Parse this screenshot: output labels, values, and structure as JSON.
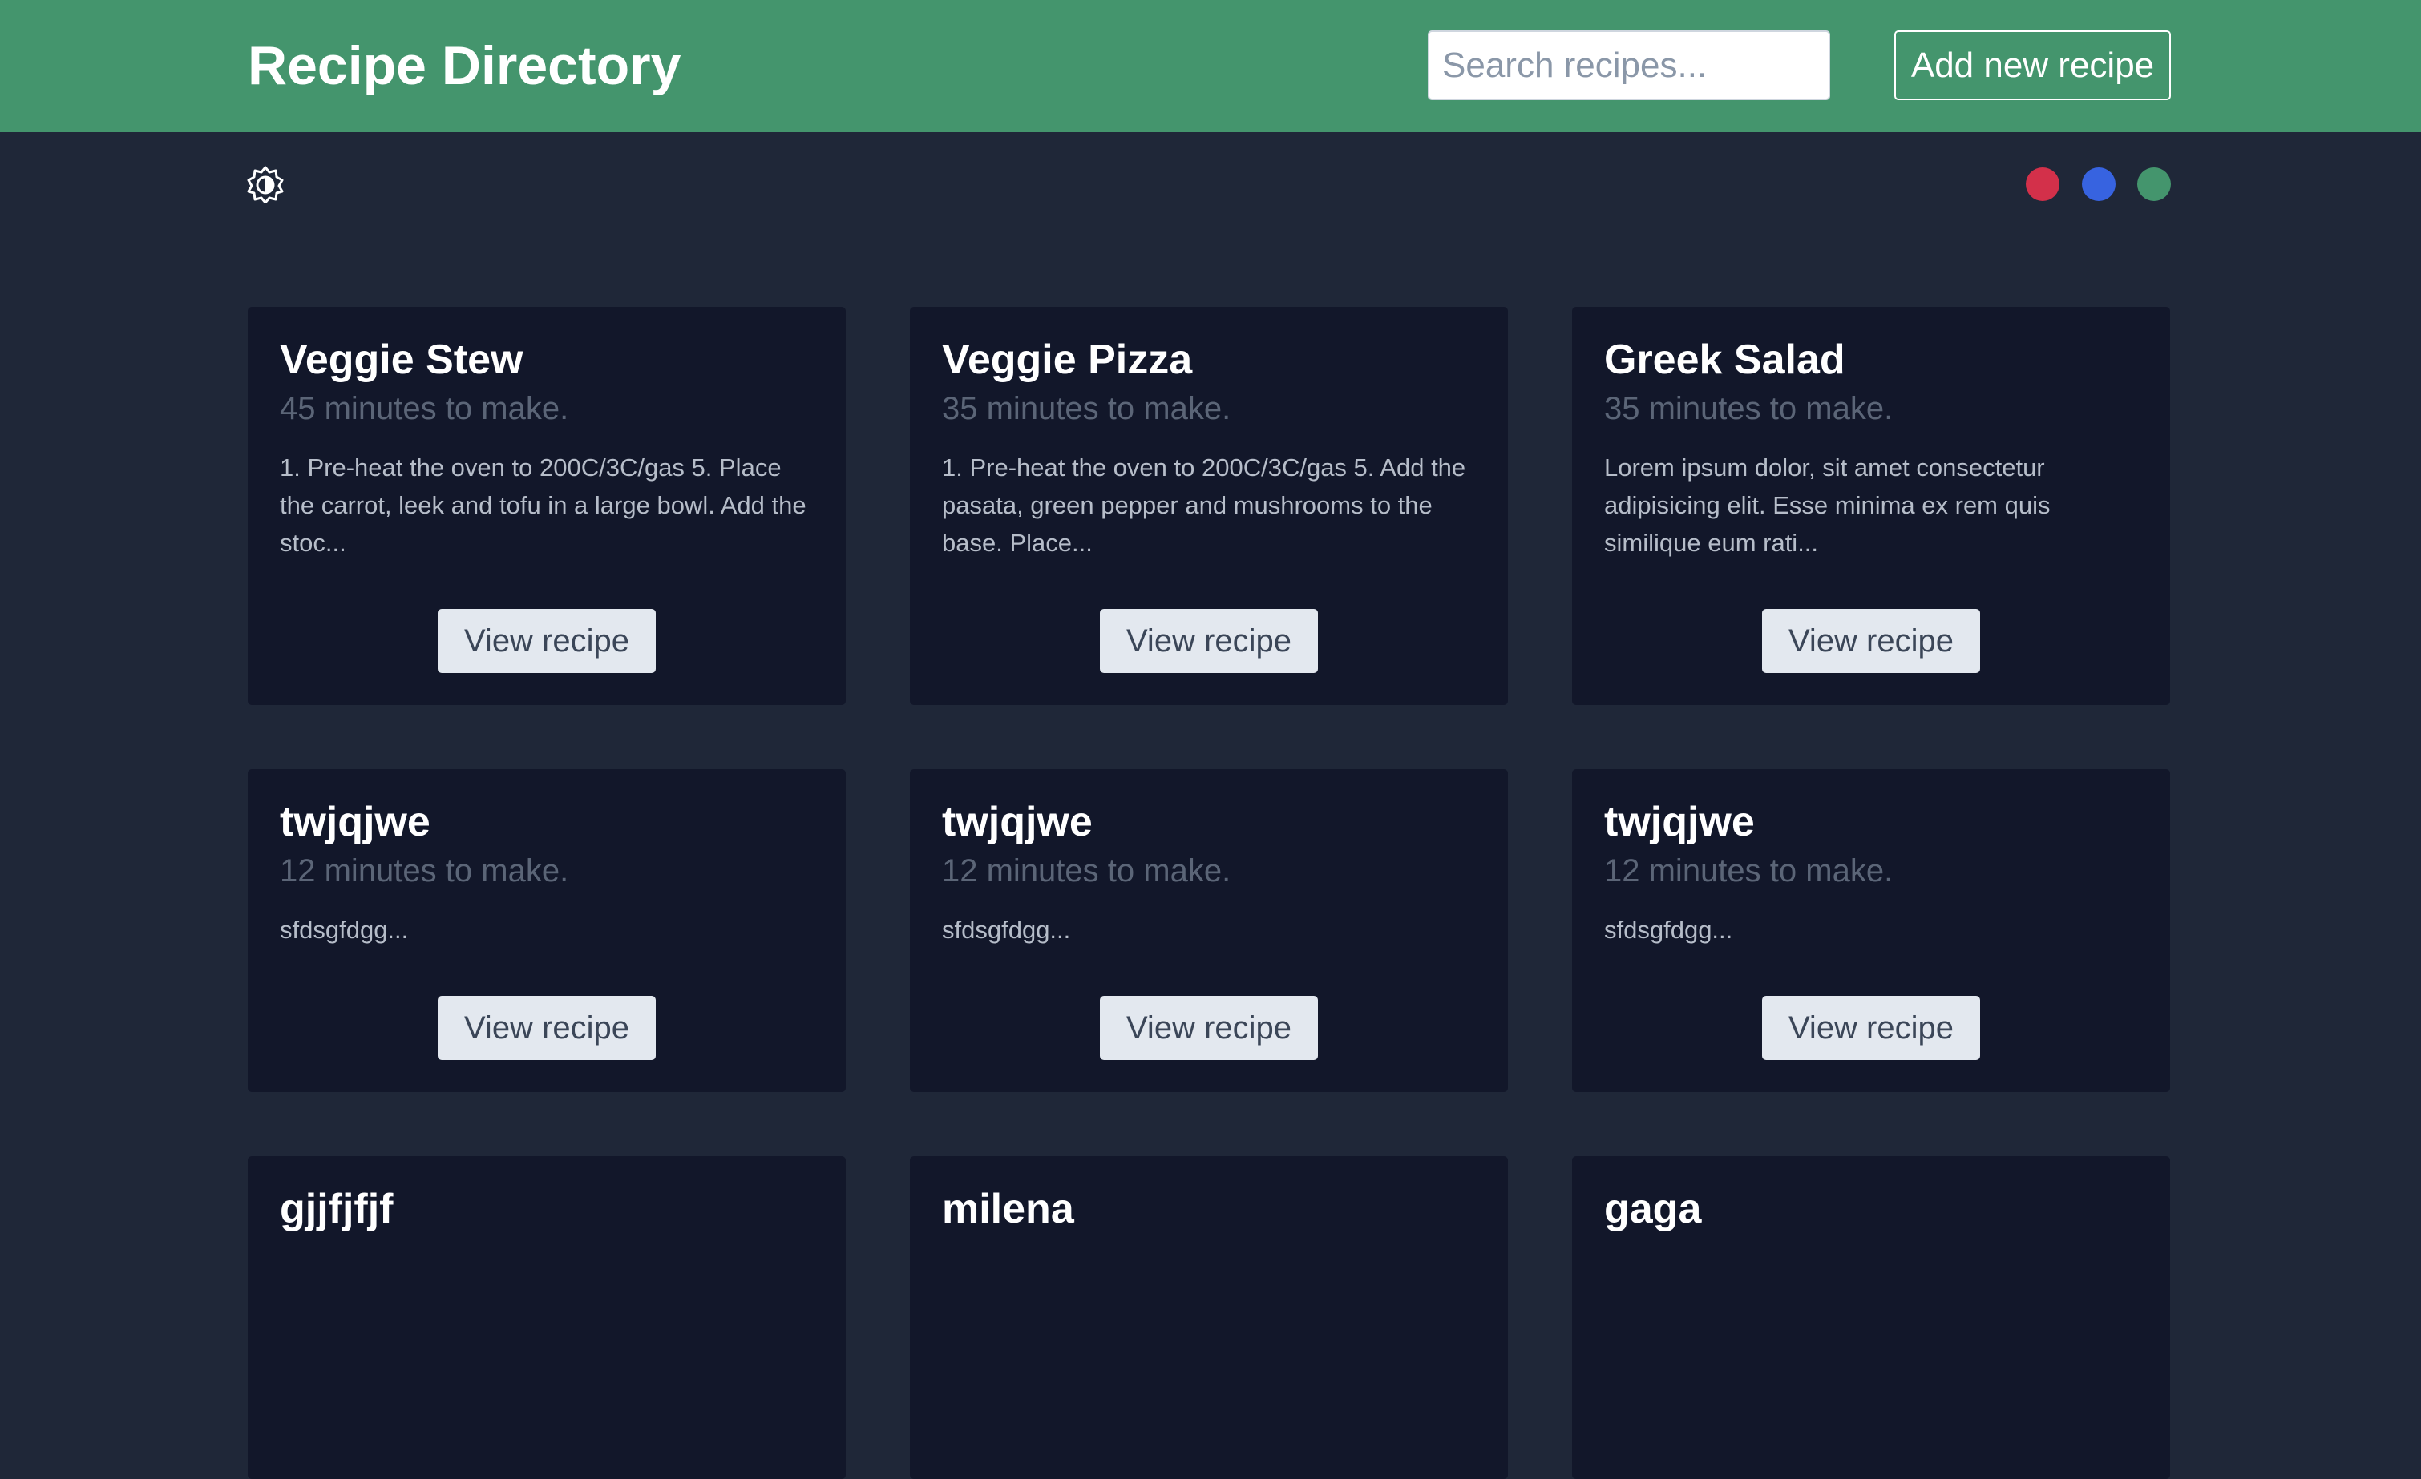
{
  "header": {
    "title": "Recipe Directory",
    "search_placeholder": "Search recipes...",
    "search_value": "",
    "add_button_label": "Add new recipe",
    "background_color": "#44956d"
  },
  "toolbar": {
    "theme_toggle_icon": "contrast-icon",
    "color_options": [
      {
        "name": "red",
        "color": "#d3304a"
      },
      {
        "name": "blue",
        "color": "#3763e0"
      },
      {
        "name": "green",
        "color": "#44956d"
      }
    ]
  },
  "recipes": [
    {
      "title": "Veggie Stew",
      "time": "45 minutes to make.",
      "description": "1. Pre-heat the oven to 200C/3C/gas 5. Place the carrot, leek and tofu in a large bowl. Add the stoc...",
      "button_label": "View recipe"
    },
    {
      "title": "Veggie Pizza",
      "time": "35 minutes to make.",
      "description": "1. Pre-heat the oven to 200C/3C/gas 5. Add the pasata, green pepper and mushrooms to the base. Place...",
      "button_label": "View recipe"
    },
    {
      "title": "Greek Salad",
      "time": "35 minutes to make.",
      "description": "Lorem ipsum dolor, sit amet consectetur adipisicing elit. Esse minima ex rem quis similique eum rati...",
      "button_label": "View recipe"
    },
    {
      "title": "twjqjwe",
      "time": "12 minutes to make.",
      "description": "sfdsgfdgg...",
      "button_label": "View recipe"
    },
    {
      "title": "twjqjwe",
      "time": "12 minutes to make.",
      "description": "sfdsgfdgg...",
      "button_label": "View recipe"
    },
    {
      "title": "twjqjwe",
      "time": "12 minutes to make.",
      "description": "sfdsgfdgg...",
      "button_label": "View recipe"
    },
    {
      "title": "gjjfjfjf",
      "time": "",
      "description": "",
      "button_label": ""
    },
    {
      "title": "milena",
      "time": "",
      "description": "",
      "button_label": ""
    },
    {
      "title": "gaga",
      "time": "",
      "description": "",
      "button_label": ""
    }
  ]
}
